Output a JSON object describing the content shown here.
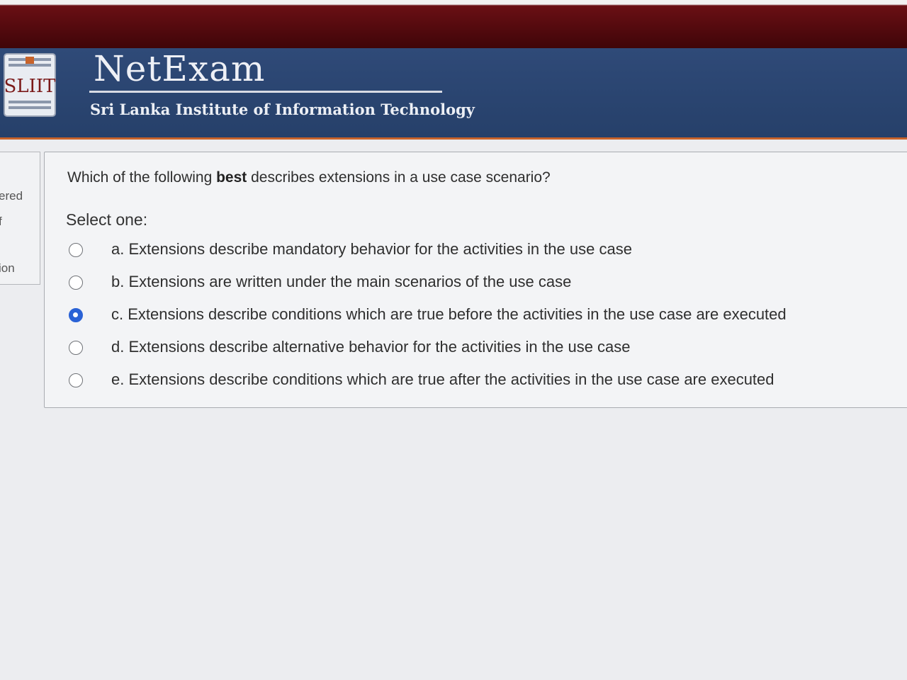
{
  "app": {
    "logo_text": "SLIIT",
    "brand": "NetExam",
    "institution": "Sri Lanka Institute of Information Technology"
  },
  "left_panel": {
    "fragments": [
      "ered",
      "f",
      "ion"
    ]
  },
  "question": {
    "text_before": "Which of the following ",
    "text_bold": "best",
    "text_after": " describes extensions in a use case scenario?",
    "prompt": "Select one:",
    "selected_index": 2,
    "options": [
      {
        "label": "a. Extensions describe mandatory behavior for the activities in the use case"
      },
      {
        "label": "b. Extensions are written under the main scenarios of the use case"
      },
      {
        "label": "c. Extensions describe conditions which are true before the activities in the use case are executed"
      },
      {
        "label": "d. Extensions describe alternative behavior for the activities in the use case"
      },
      {
        "label": "e. Extensions describe conditions which are true after the activities in the use case are executed"
      }
    ]
  },
  "colors": {
    "header_blue": "#2f4a78",
    "top_maroon": "#4a070b",
    "accent_orange": "#c8632a",
    "radio_selected": "#2a62d6"
  }
}
